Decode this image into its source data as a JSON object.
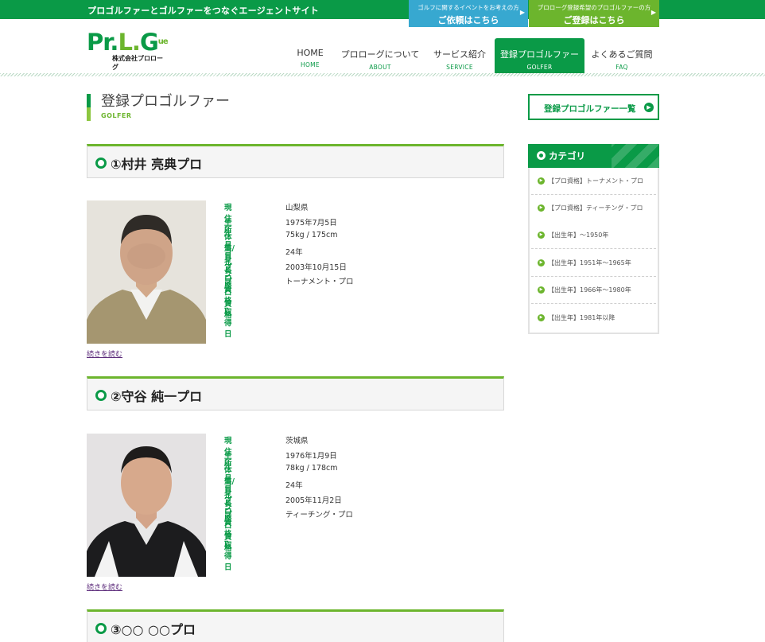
{
  "topbar": {
    "tagline": "プロゴルファーとゴルファーをつなぐエージェントサイト",
    "btn_event_sub": "ゴルフに関するイベントをお考えの方",
    "btn_event_main": "ご依頼はこちら",
    "btn_register_sub": "プロローグ登録希望のプロゴルファーの方",
    "btn_register_main": "ご登録はこちら"
  },
  "logo": {
    "mark_a": "Pr.",
    "mark_b": "L.",
    "mark_c": "G",
    "mark_d": "ue",
    "company": "株式会社プロローグ"
  },
  "nav": [
    {
      "jp": "HOME",
      "en": "HOME"
    },
    {
      "jp": "プロローグについて",
      "en": "ABOUT"
    },
    {
      "jp": "サービス紹介",
      "en": "SERVICE"
    },
    {
      "jp": "登録プロゴルファー",
      "en": "GOLFER"
    },
    {
      "jp": "よくあるご質問",
      "en": "FAQ"
    }
  ],
  "page_title": {
    "jp": "登録プロゴルファー",
    "en": "GOLFER"
  },
  "labels": {
    "residence": "現住所",
    "birthday": "生年月日",
    "body": "体重/身長",
    "history": "ゴルフ歴",
    "acquired": "プロ資格取得日",
    "license": "プロ資格",
    "more": "続きを読む"
  },
  "golfers": [
    {
      "name": "①村井 亮典プロ",
      "residence": "山梨県",
      "birthday": "1975年7月5日",
      "body": "75kg / 175cm",
      "history": "24年",
      "acquired": "2003年10月15日",
      "license": "トーナメント・プロ"
    },
    {
      "name": "②守谷 純一プロ",
      "residence": "茨城県",
      "birthday": "1976年1月9日",
      "body": "78kg / 178cm",
      "history": "24年",
      "acquired": "2005年11月2日",
      "license": "ティーチング・プロ"
    },
    {
      "name": "③○○ ○○プロ"
    }
  ],
  "sidebar": {
    "list_button": "登録プロゴルファー一覧",
    "category_title": "カテゴリ",
    "categories": [
      "【プロ資格】トーナメント・プロ",
      "【プロ資格】ティーチング・プロ",
      "【出生年】～1950年",
      "【出生年】1951年～1965年",
      "【出生年】1966年～1980年",
      "【出生年】1981年以降"
    ]
  },
  "colors": {
    "brand_green": "#0a9a47",
    "accent_green": "#6cb52d",
    "blue": "#37a8d0"
  }
}
